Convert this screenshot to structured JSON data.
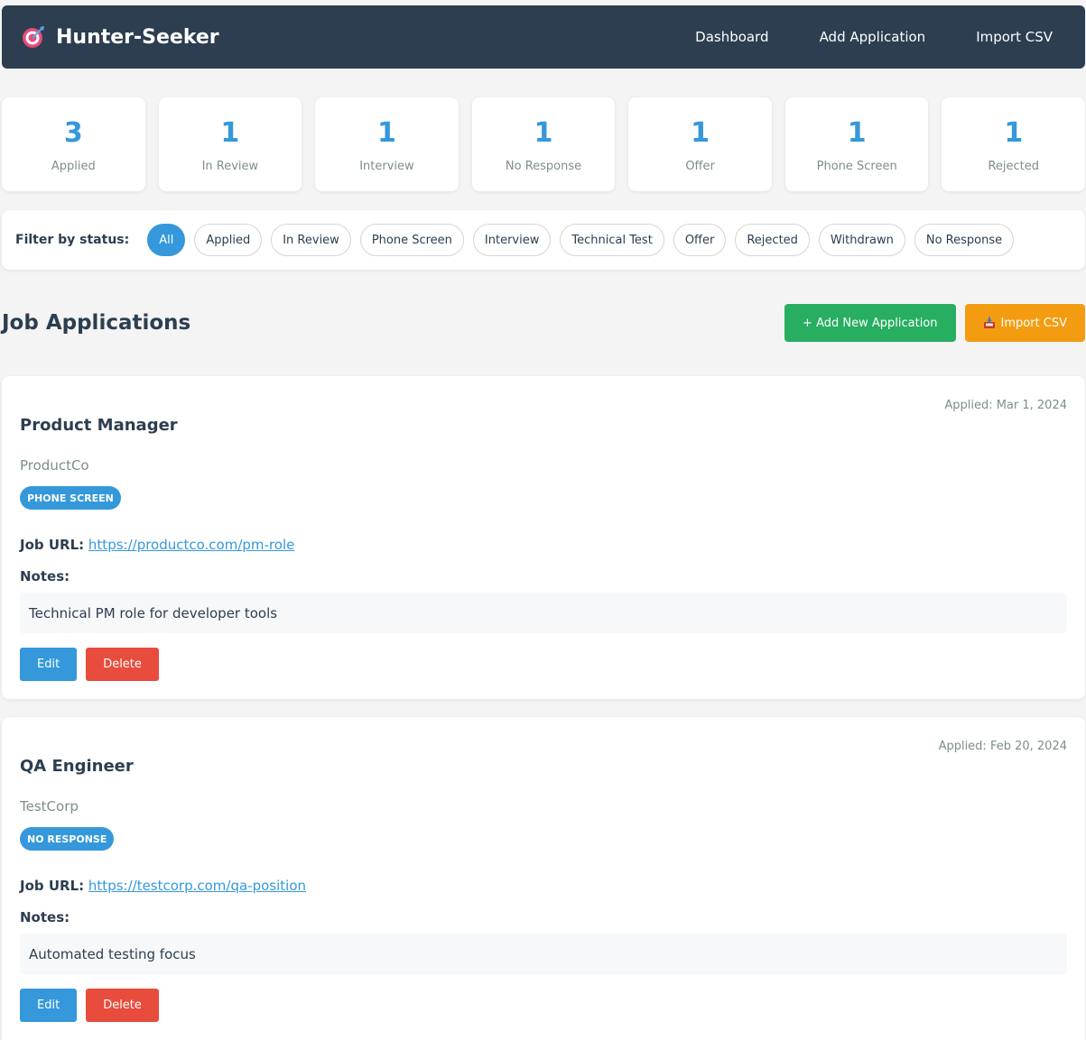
{
  "nav": {
    "brand": "Hunter-Seeker",
    "brand_icon": "target-icon",
    "links": [
      "Dashboard",
      "Add Application",
      "Import CSV"
    ]
  },
  "stats": [
    {
      "count": "3",
      "label": "Applied"
    },
    {
      "count": "1",
      "label": "In Review"
    },
    {
      "count": "1",
      "label": "Interview"
    },
    {
      "count": "1",
      "label": "No Response"
    },
    {
      "count": "1",
      "label": "Offer"
    },
    {
      "count": "1",
      "label": "Phone Screen"
    },
    {
      "count": "1",
      "label": "Rejected"
    }
  ],
  "filter": {
    "title": "Filter by status:",
    "options": [
      "All",
      "Applied",
      "In Review",
      "Phone Screen",
      "Interview",
      "Technical Test",
      "Offer",
      "Rejected",
      "Withdrawn",
      "No Response"
    ],
    "active": "All"
  },
  "list": {
    "title": "Job Applications",
    "add_button": "+ Add New Application",
    "import_button": "Import CSV",
    "import_icon": "inbox-tray-icon"
  },
  "applications": [
    {
      "date": "Applied: Mar 1, 2024",
      "title": "Product Manager",
      "company": "ProductCo",
      "status": "Phone Screen",
      "url_label": "Job URL:",
      "url": "https://productco.com/pm-role",
      "notes_label": "Notes:",
      "notes": "Technical PM role for developer tools",
      "edit": "Edit",
      "delete": "Delete"
    },
    {
      "date": "Applied: Feb 20, 2024",
      "title": "QA Engineer",
      "company": "TestCorp",
      "status": "No Response",
      "url_label": "Job URL:",
      "url": "https://testcorp.com/qa-position",
      "notes_label": "Notes:",
      "notes": "Automated testing focus",
      "edit": "Edit",
      "delete": "Delete"
    }
  ],
  "colors": {
    "nav_bg": "#2c3e50",
    "accent": "#3498db",
    "green": "#27ae60",
    "orange": "#f39c12",
    "red": "#e74c3c"
  }
}
